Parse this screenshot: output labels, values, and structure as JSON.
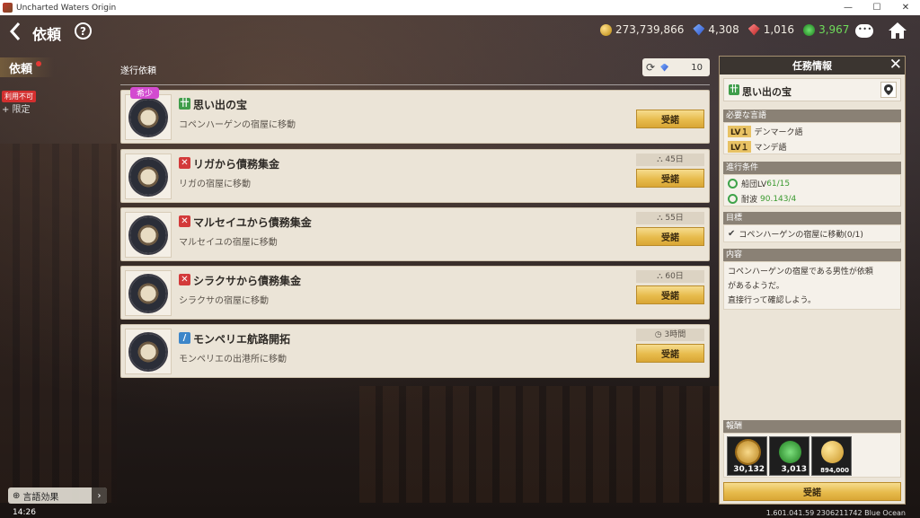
{
  "window": {
    "title": "Uncharted Waters Origin",
    "controls": [
      "—",
      "☐",
      "✕"
    ]
  },
  "header": {
    "title": "依頼",
    "back_icon": "chevron-left-icon",
    "help_label": "?",
    "currencies": [
      {
        "icon": "gold-coin-icon",
        "value": "273,739,866"
      },
      {
        "icon": "blue-gem-icon",
        "value": "4,308"
      },
      {
        "icon": "red-gem-icon",
        "value": "1,016"
      },
      {
        "icon": "green-wheel-icon",
        "value": "3,967"
      }
    ]
  },
  "sidebar": {
    "tab_label": "依頼",
    "unavailable_label": "利用不可",
    "limited_label": "+ 限定"
  },
  "list": {
    "title": "遂行依頼",
    "refresh_count": "10",
    "quests": [
      {
        "title": "思い出の宝",
        "desc": "コペンハーゲンの宿屋に移動",
        "category": "green",
        "cat_glyph": "卄",
        "rare": "希少",
        "duration": "",
        "button": "受諾"
      },
      {
        "title": "リガから債務集金",
        "desc": "リガの宿屋に移動",
        "category": "red",
        "cat_glyph": "✕",
        "rare": "",
        "duration": "45日",
        "button": "受諾"
      },
      {
        "title": "マルセイユから債務集金",
        "desc": "マルセイユの宿屋に移動",
        "category": "red",
        "cat_glyph": "✕",
        "rare": "",
        "duration": "55日",
        "button": "受諾"
      },
      {
        "title": "シラクサから債務集金",
        "desc": "シラクサの宿屋に移動",
        "category": "red",
        "cat_glyph": "✕",
        "rare": "",
        "duration": "60日",
        "button": "受諾"
      },
      {
        "title": "モンペリエ航路開拓",
        "desc": "モンペリエの出港所に移動",
        "category": "blue",
        "cat_glyph": "/",
        "rare": "",
        "duration": "3時間",
        "button": "受諾"
      }
    ]
  },
  "panel": {
    "header": "任務情報",
    "quest_title": "思い出の宝",
    "language_head": "必要な言語",
    "languages": [
      {
        "lv": "LV１",
        "name": "デンマーク語"
      },
      {
        "lv": "LV１",
        "name": "マンデ語"
      }
    ],
    "conditions_head": "進行条件",
    "conditions": [
      {
        "label": "船団LV",
        "value": "61/15"
      },
      {
        "label": "耐波",
        "value": "90.143/4"
      }
    ],
    "goal_head": "目標",
    "goal": "コペンハーゲンの宿屋に移動(0/1)",
    "content_head": "内容",
    "content_lines": [
      "コペンハーゲンの宿屋である男性が依頼",
      "があるようだ。",
      "直接行って確認しよう。"
    ],
    "rewards_head": "報酬",
    "rewards": [
      {
        "icon": "medal-icon",
        "value": "30,132"
      },
      {
        "icon": "star-wreath-icon",
        "value": "3,013"
      },
      {
        "icon": "gold-coin-icon",
        "value": "894,000"
      }
    ],
    "accept_label": "受諾"
  },
  "footer": {
    "lang_effect_label": "言語効果",
    "time": "14:26",
    "version": "1.601.041.59 2306211742 Blue Ocean"
  }
}
